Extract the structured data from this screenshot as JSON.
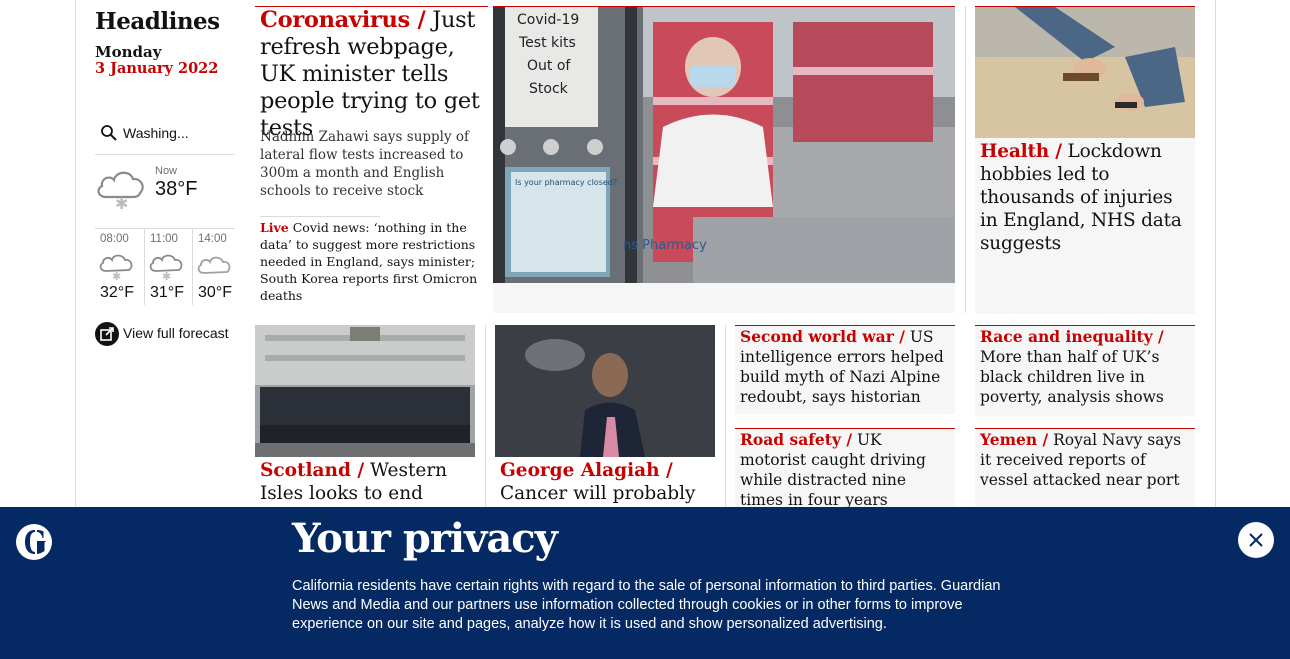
{
  "rail": {
    "title": "Headlines",
    "day": "Monday",
    "date": "3 January 2022",
    "location": "Washing...",
    "weather_now": {
      "label": "Now",
      "temp": "38°F",
      "icon": "sleet-cloud-icon"
    },
    "hourly": [
      {
        "time": "08:00",
        "temp": "32°F",
        "icon": "sleet-cloud-icon"
      },
      {
        "time": "11:00",
        "temp": "31°F",
        "icon": "sleet-cloud-icon"
      },
      {
        "time": "14:00",
        "temp": "30°F",
        "icon": "cloud-icon"
      }
    ],
    "forecast_link": "View full forecast"
  },
  "main_story": {
    "kicker": "Coronavirus /",
    "headline": " Just refresh webpage, UK minister tells people trying to get tests",
    "standfirst": "Nadhim Zahawi says supply of lateral flow tests increased to 300m a month and English schools to receive stock",
    "live_kicker": "Live",
    "live_text": " Covid news: ‘nothing in the data’ to suggest more restrictions needed in England, says minister; South Korea reports first Omicron deaths",
    "image_sign": [
      "Covid-19",
      "Test kits",
      "Out of",
      "Stock"
    ],
    "image_poster": "Is your pharmacy closed?",
    "image_brand": "ns Pharmacy"
  },
  "health_story": {
    "kicker": "Health /",
    "headline": " Lockdown hobbies led to thousands of injuries in England, NHS data suggests"
  },
  "row2": [
    {
      "kicker": "Scotland /",
      "headline": " Western Isles looks to end"
    },
    {
      "kicker": "George Alagiah /",
      "headline": " Cancer will probably"
    }
  ],
  "small_stories": [
    {
      "kicker": "Second world war /",
      "headline": " US intelligence errors helped build myth of Nazi Alpine redoubt, says historian"
    },
    {
      "kicker": "Road safety /",
      "headline": " UK motorist caught driving while distracted nine times in four years"
    },
    {
      "kicker": "Race and inequality /",
      "headline": " More than half of UK’s black children live in poverty, analysis shows"
    },
    {
      "kicker": "Yemen /",
      "headline": " Royal Navy says it received reports of vessel attacked near port"
    }
  ],
  "privacy": {
    "title": "Your privacy",
    "text": "California residents have certain rights with regard to the sale of personal information to third parties. Guardian News and Media and our partners use information collected through cookies or in other forms to improve experience on our site and pages, analyze how it is used and show personalized advertising.",
    "logo_icon": "guardian-g-logo",
    "close_icon": "close-icon"
  },
  "colors": {
    "accent": "#c70000",
    "banner": "#052962",
    "panel": "#f6f6f6"
  }
}
